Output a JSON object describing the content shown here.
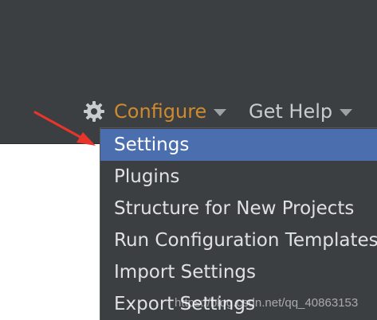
{
  "toolbar": {
    "configure_label": "Configure",
    "get_help_label": "Get Help",
    "gear_icon": "gear-icon",
    "accent_color": "#cf8a2e"
  },
  "menu": {
    "items": [
      {
        "label": "Settings",
        "selected": true
      },
      {
        "label": "Plugins",
        "selected": false
      },
      {
        "label": "Structure for New Projects",
        "selected": false
      },
      {
        "label": "Run Configuration Templates",
        "selected": false
      },
      {
        "label": "Import Settings",
        "selected": false
      },
      {
        "label": "Export Settings",
        "selected": false
      }
    ],
    "selected_color": "#4b6eaf"
  },
  "annotation": {
    "arrow_color": "#e8352b"
  },
  "watermark": "https://blog.csdn.net/qq_40863153"
}
